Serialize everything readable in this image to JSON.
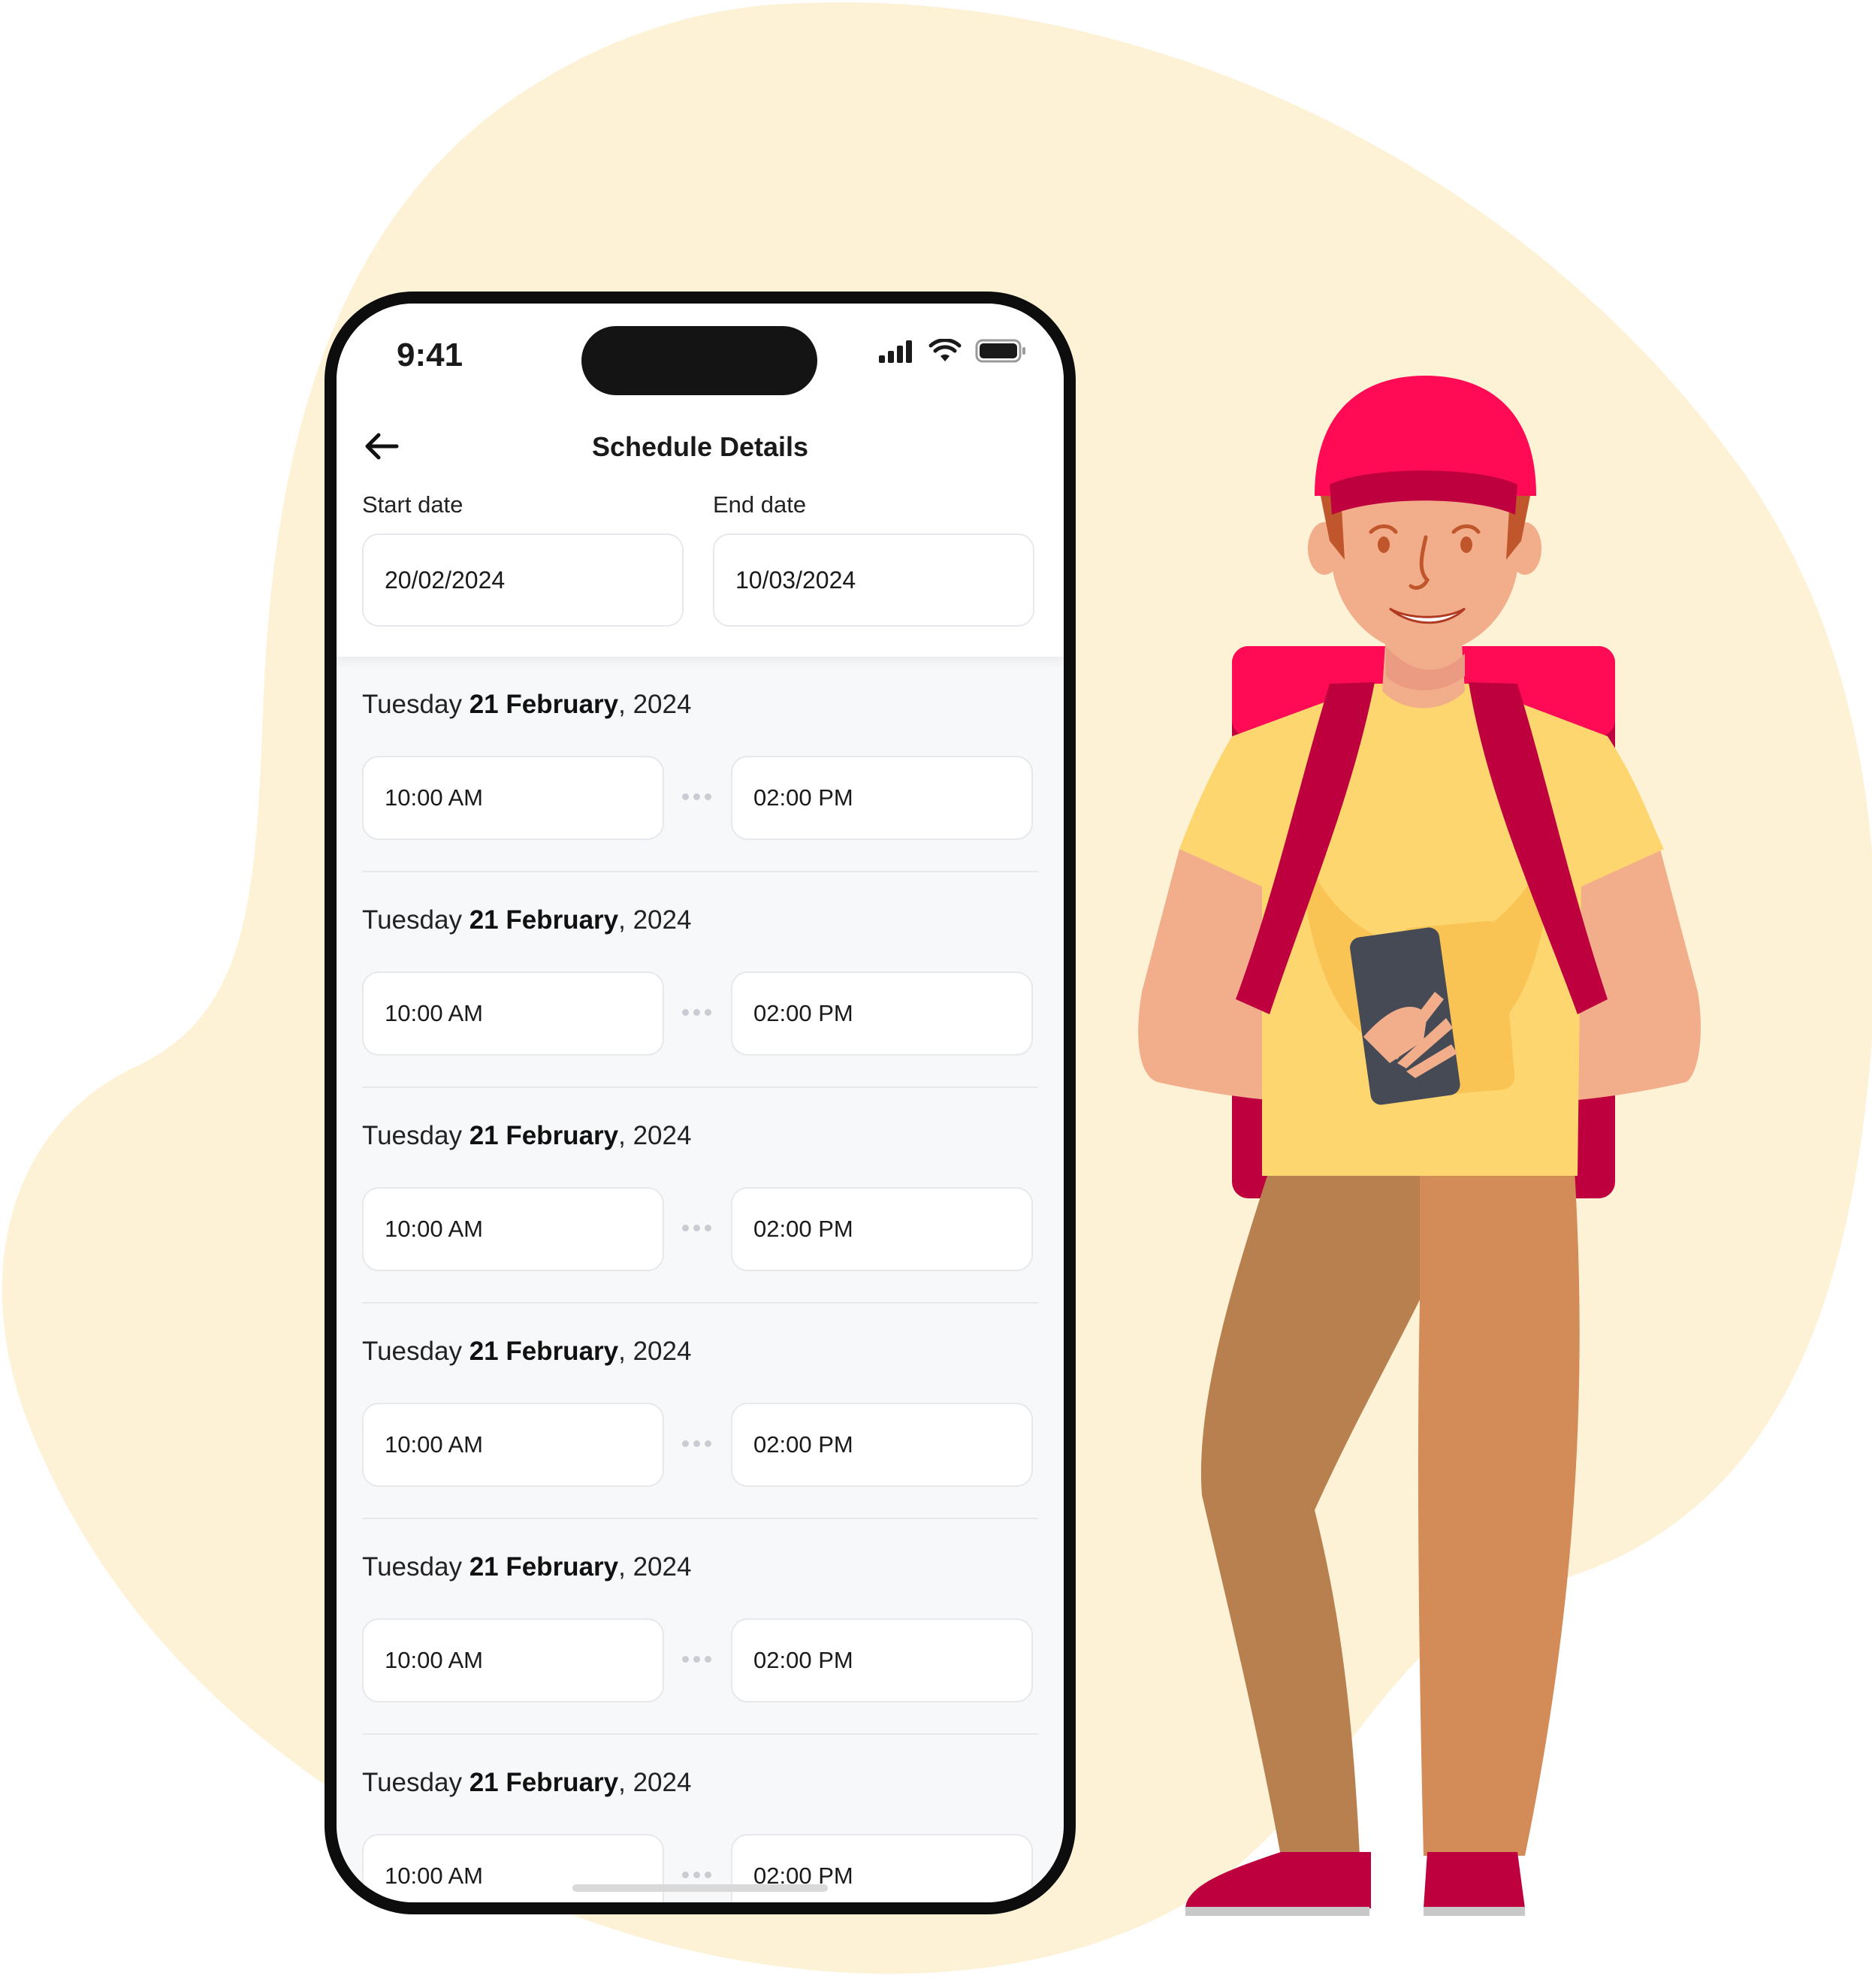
{
  "colors": {
    "blob": "#fdf2d6",
    "cap": "#ff0a54",
    "backpack": "#be003f",
    "shirt": "#fdd670",
    "skin": "#f2ae8a",
    "pants_dark": "#b87f4f",
    "pants_light": "#d38c58"
  },
  "status_bar": {
    "time": "9:41",
    "icons": [
      "signal-icon",
      "wifi-icon",
      "battery-icon"
    ]
  },
  "header": {
    "title": "Schedule Details",
    "back_icon": "arrow-left-icon"
  },
  "date_range": {
    "start_label": "Start date",
    "start_value": "20/02/2024",
    "end_label": "End date",
    "end_value": "10/03/2024"
  },
  "schedule": [
    {
      "weekday": "Tuesday",
      "day_month": "21 February",
      "year": ", 2024",
      "start": "10:00 AM",
      "end": "02:00 PM"
    },
    {
      "weekday": "Tuesday",
      "day_month": "21 February",
      "year": ", 2024",
      "start": "10:00 AM",
      "end": "02:00 PM"
    },
    {
      "weekday": "Tuesday",
      "day_month": "21 February",
      "year": ", 2024",
      "start": "10:00 AM",
      "end": "02:00 PM"
    },
    {
      "weekday": "Tuesday",
      "day_month": "21 February",
      "year": ", 2024",
      "start": "10:00 AM",
      "end": "02:00 PM"
    },
    {
      "weekday": "Tuesday",
      "day_month": "21 February",
      "year": ", 2024",
      "start": "10:00 AM",
      "end": "02:00 PM"
    },
    {
      "weekday": "Tuesday",
      "day_month": "21 February",
      "year": ", 2024",
      "start": "10:00 AM",
      "end": "02:00 PM"
    }
  ]
}
